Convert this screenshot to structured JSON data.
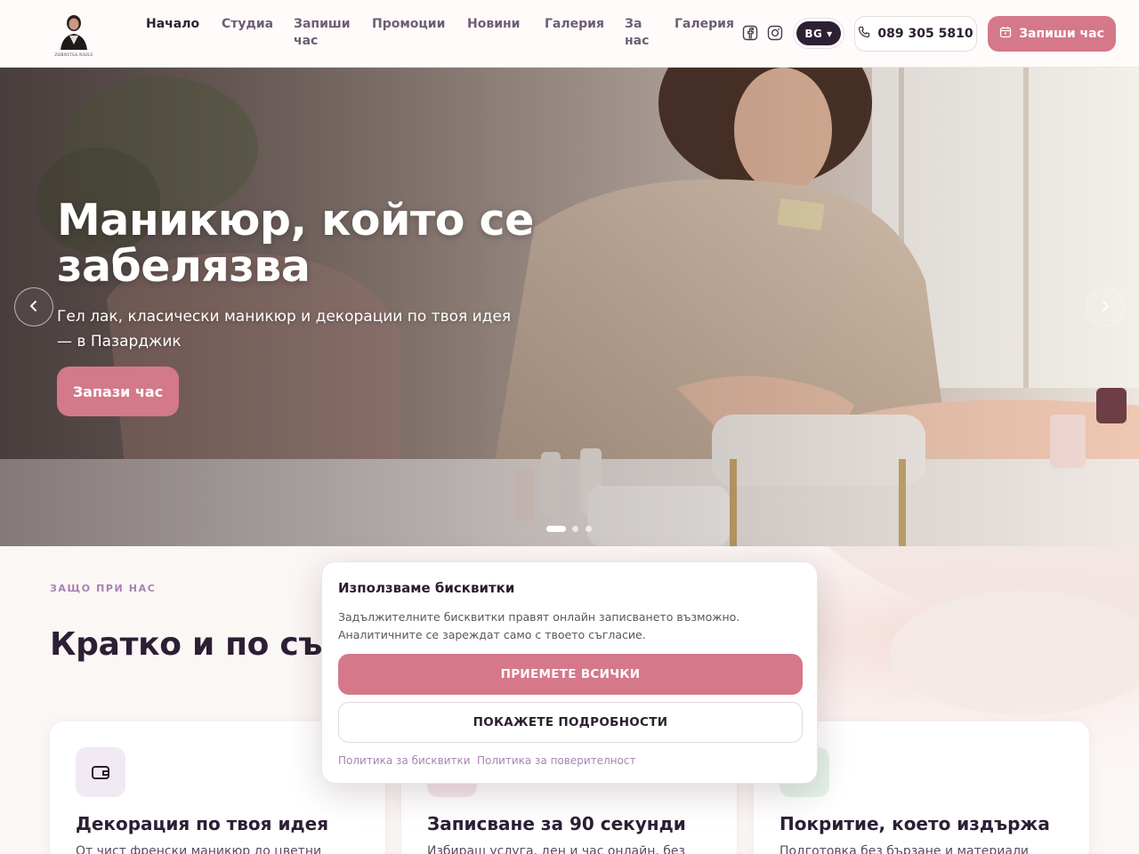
{
  "brand": {
    "logo_text": "ZORNITSA NAILS",
    "accent": "#d5788a",
    "dark": "#2e2033"
  },
  "nav": {
    "items": [
      {
        "label": "Начало",
        "active": true
      },
      {
        "label": "Студиа"
      },
      {
        "label": "Запиши час"
      },
      {
        "label": "Промоции"
      },
      {
        "label": "Новини"
      },
      {
        "label": "Галерия"
      },
      {
        "label": "За нас"
      },
      {
        "label": "Галерия"
      }
    ],
    "social": [
      "facebook-icon",
      "instagram-icon"
    ],
    "language": "BG ▾",
    "phone": "089 305 5810",
    "book_label": "Запиши час"
  },
  "hero": {
    "title": "Маникюр, който се забелязва",
    "subtitle": "Гел лак, класически маникюр и декорации по твоя идея — в Пазарджик",
    "cta": "Запази час",
    "slides_total": 3,
    "slide_active": 1
  },
  "why": {
    "eyebrow": "ЗАЩО ПРИ НАС",
    "title": "Кратко и по същество",
    "cards": [
      {
        "title": "Декорация по твоя идея",
        "text": "От чист френски маникюр до цветни",
        "icon": "wallet-icon"
      },
      {
        "title": "Записване за 90 секунди",
        "text": "Избираш услуга, ден и час онлайн, без",
        "icon": "calendar-icon"
      },
      {
        "title": "Покритие, което издържа",
        "text": "Подготовка без бързане и материали",
        "icon": "shield-icon"
      }
    ]
  },
  "cookie": {
    "title": "Използваме бисквитки",
    "text": "Задължителните бисквитки правят онлайн записването възможно. Аналитичните се зареждат само с твоето съгласие.",
    "accept": "ПРИЕМЕТЕ ВСИЧКИ",
    "details": "ПОКАЖЕТЕ ПОДРОБНОСТИ",
    "link_cookies": "Политика за бисквитки",
    "link_privacy": "Политика за поверителност"
  }
}
